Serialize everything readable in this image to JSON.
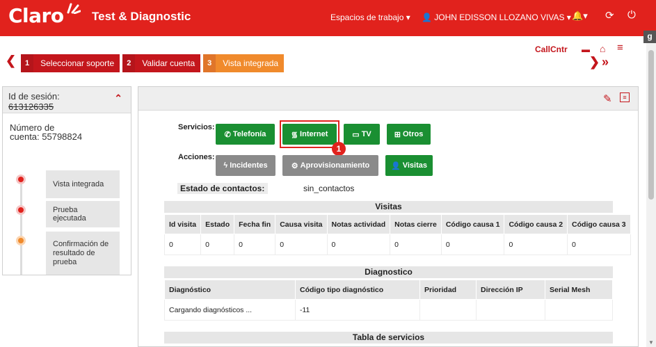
{
  "header": {
    "brand": "Claro",
    "app_title": "Test & Diagnostic",
    "workspaces": "Espacios de trabajo",
    "user": "JOHN EDISSON LLOZANO VIVAS",
    "extension_badge": "g"
  },
  "wizard": {
    "steps": [
      {
        "num": "1",
        "label": "Seleccionar soporte",
        "state": "done"
      },
      {
        "num": "2",
        "label": "Validar cuenta",
        "state": "done"
      },
      {
        "num": "3",
        "label": "Vista integrada",
        "state": "active"
      }
    ],
    "callcntr": "CallCntr"
  },
  "left": {
    "session_label": "Id de sesión:",
    "session_id": "613126335",
    "account_label": "Número de",
    "account_value": "cuenta: 55798824",
    "timeline": [
      {
        "label": "Vista integrada",
        "color": "#e1221d"
      },
      {
        "label": "Prueba ejecutada",
        "color": "#e1221d"
      },
      {
        "label": "Confirmación de resultado de prueba",
        "color": "#f08a2c"
      }
    ]
  },
  "main": {
    "servicios_label": "Servicios:",
    "acciones_label": "Acciones:",
    "servicios": [
      "Telefonía",
      "Internet",
      "TV",
      "Otros"
    ],
    "acciones": [
      "Incidentes",
      "Aprovisionamiento",
      "Visitas"
    ],
    "marker": "1",
    "estado_label": "Estado de contactos:",
    "estado_value": "sin_contactos",
    "visitas": {
      "title": "Visitas",
      "headers": [
        "Id visita",
        "Estado",
        "Fecha fin",
        "Causa visita",
        "Notas actividad",
        "Notas cierre",
        "Código causa 1",
        "Código causa 2",
        "Código causa 3"
      ],
      "row": [
        "0",
        "0",
        "0",
        "0",
        "0",
        "0",
        "0",
        "0",
        "0"
      ]
    },
    "diagnostico": {
      "title": "Diagnostico",
      "headers": [
        "Diagnóstico",
        "Código tipo diagnóstico",
        "Prioridad",
        "Dirección IP",
        "Serial Mesh"
      ],
      "row": [
        "Cargando diagnósticos ...",
        "-11",
        "",
        "",
        ""
      ]
    },
    "servicios_table_title": "Tabla de servicios"
  },
  "colors": {
    "brand_red": "#e1221d",
    "green": "#1a8f32",
    "gray": "#8a8a8a",
    "orange": "#f08a2c"
  }
}
